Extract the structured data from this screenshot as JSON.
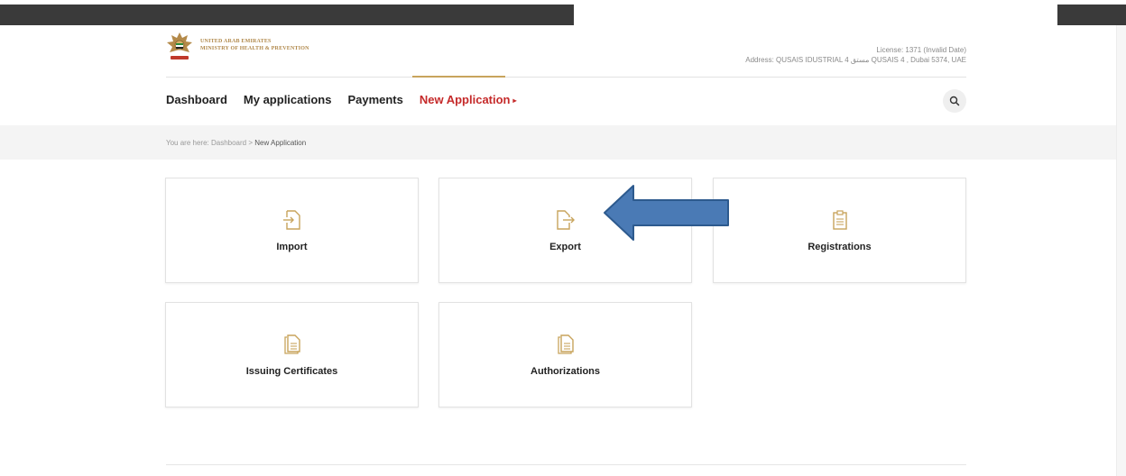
{
  "header": {
    "ministry_line1": "UNITED ARAB EMIRATES",
    "ministry_line2": "MINISTRY OF HEALTH & PREVENTION",
    "license": "License: 1371 (Invalid Date)",
    "address": "Address: QUSAIS IDUSTRIAL 4 مستق QUSAIS 4 , Dubai 5374, UAE"
  },
  "nav": {
    "items": [
      {
        "label": "Dashboard"
      },
      {
        "label": "My applications"
      },
      {
        "label": "Payments"
      },
      {
        "label": "New Application"
      }
    ],
    "active_caret": "▸"
  },
  "breadcrumb": {
    "prefix": "You are here:",
    "home": "Dashboard",
    "separator": ">",
    "current": "New Application"
  },
  "cards": [
    {
      "label": "Import",
      "icon": "import-icon"
    },
    {
      "label": "Export",
      "icon": "export-icon"
    },
    {
      "label": "Registrations",
      "icon": "clipboard-icon"
    },
    {
      "label": "Issuing Certificates",
      "icon": "document-icon"
    },
    {
      "label": "Authorizations",
      "icon": "document-icon"
    }
  ],
  "colors": {
    "accent_gold": "#c8a45c",
    "active_red": "#c52a2a",
    "annotation_arrow": "#4a7ab5"
  }
}
